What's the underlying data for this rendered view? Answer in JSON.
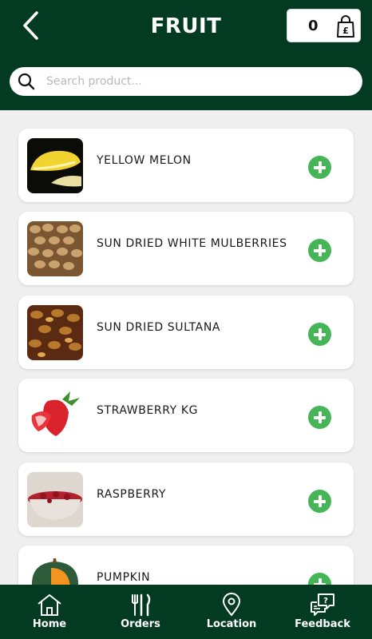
{
  "header": {
    "title": "FRUIT",
    "cart_count": "0"
  },
  "search": {
    "placeholder": "Search product..."
  },
  "products": [
    {
      "name": "YELLOW MELON"
    },
    {
      "name": "SUN DRIED WHITE MULBERRIES"
    },
    {
      "name": "SUN DRIED SULTANA"
    },
    {
      "name": "STRAWBERRY KG"
    },
    {
      "name": "RASPBERRY"
    },
    {
      "name": "PUMPKIN"
    }
  ],
  "nav": {
    "home": "Home",
    "orders": "Orders",
    "location": "Location",
    "feedback": "Feedback"
  },
  "colors": {
    "header_bg": "#033a22",
    "add_button": "#46b557",
    "page_bg": "#efefef"
  }
}
